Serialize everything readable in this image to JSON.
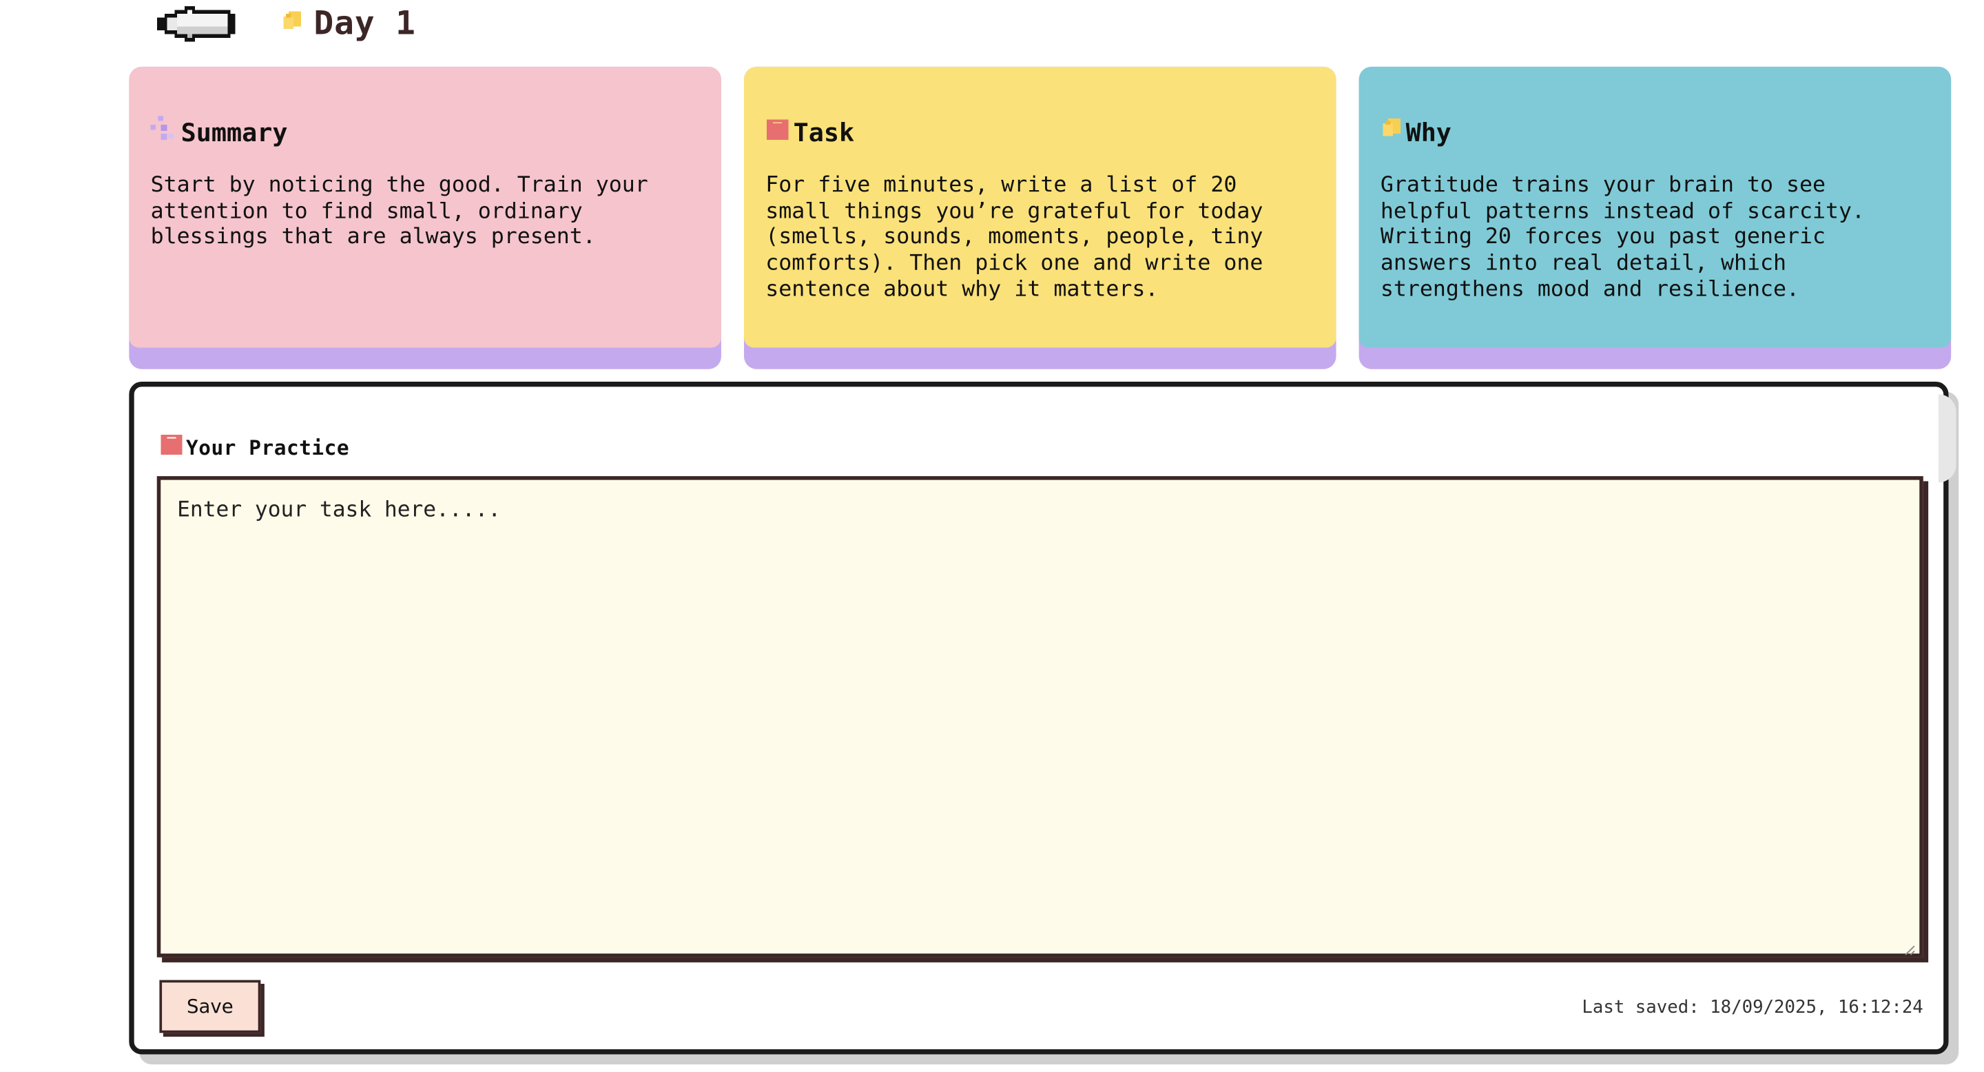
{
  "header": {
    "back_icon": "pixel-arrow-left-icon",
    "title_icon": "yellow-sticky-note-icon",
    "title": "Day 1"
  },
  "cards": [
    {
      "key": "summary",
      "icon": "sparkle-icon",
      "title": "Summary",
      "body": "Start by noticing the good. Train your\nattention to find small, ordinary\nblessings that are always present.",
      "color": "#f5c4cd"
    },
    {
      "key": "task",
      "icon": "red-shirt-icon",
      "title": "Task",
      "body": "For five minutes, write a list of 20\nsmall things you’re grateful for today\n(smells, sounds, moments, people, tiny\ncomforts). Then pick one and write one\nsentence about why it matters.",
      "color": "#fae17a"
    },
    {
      "key": "why",
      "icon": "yellow-sticky-note-icon",
      "title": "Why",
      "body": "Gratitude trains your brain to see\nhelpful patterns instead of scarcity.\nWriting 20 forces you past generic\nanswers into real detail, which\nstrengthens mood and resilience.",
      "color": "#7fcad6"
    }
  ],
  "card_shadow_color": "#c4a9ee",
  "practice": {
    "icon": "red-shirt-icon",
    "label": "Your Practice",
    "placeholder": "Enter your task here.....",
    "value": "",
    "save_label": "Save",
    "last_saved": "Last saved: 18/09/2025, 16:12:24"
  }
}
